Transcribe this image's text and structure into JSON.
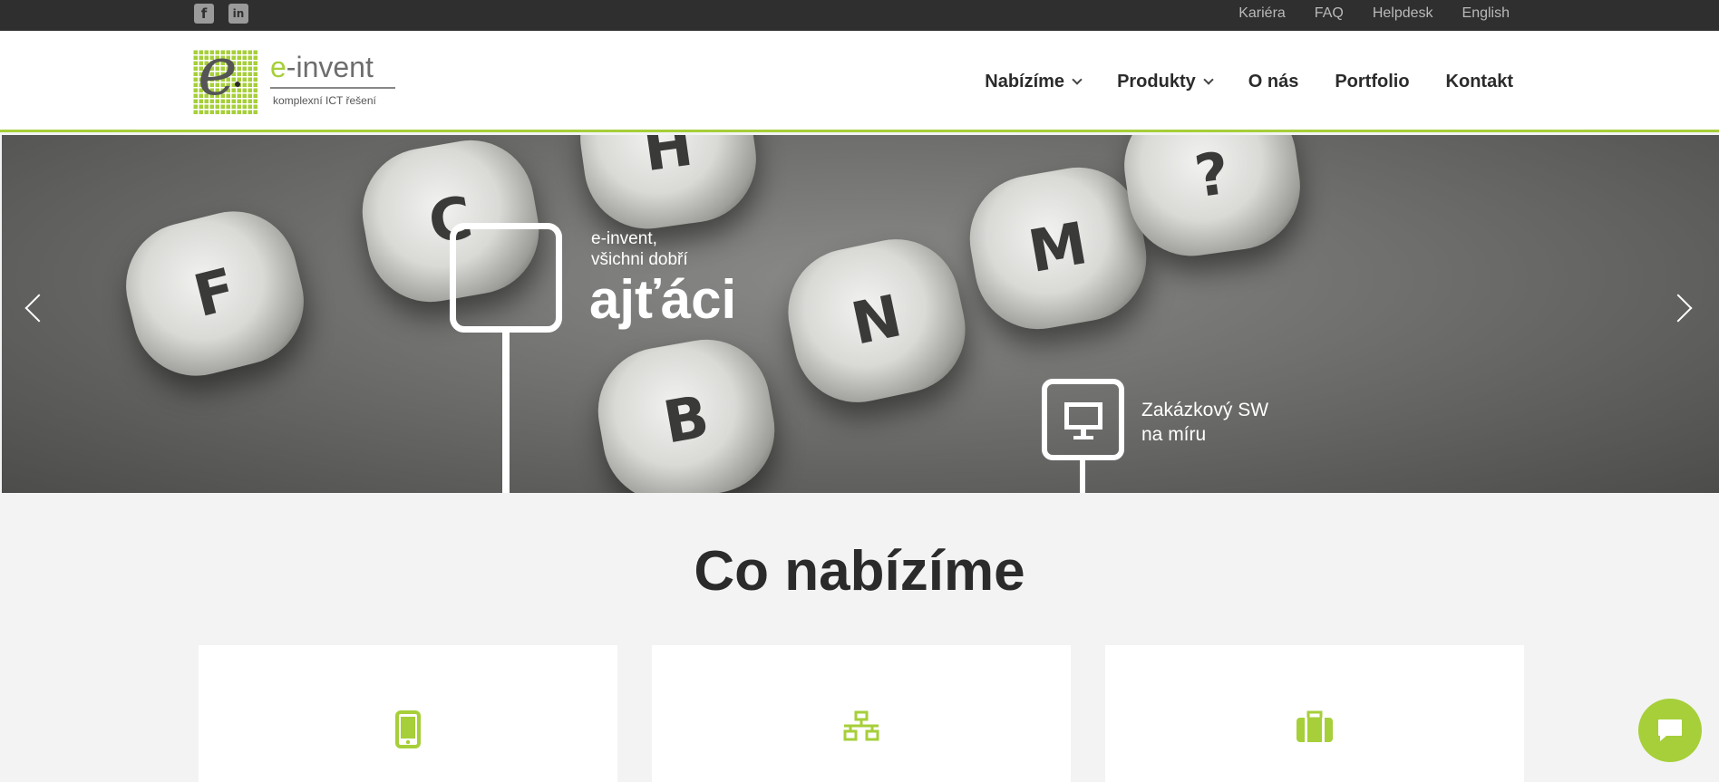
{
  "topbar": {
    "social": [
      {
        "icon": "facebook-icon",
        "glyph": "f"
      },
      {
        "icon": "linkedin-icon",
        "glyph": "in"
      }
    ],
    "links": [
      "Kariéra",
      "FAQ",
      "Helpdesk",
      "English"
    ]
  },
  "logo": {
    "prefix": "e",
    "name": "-invent",
    "tagline": "komplexní ICT řešení"
  },
  "nav": {
    "items": [
      {
        "label": "Nabízíme",
        "dropdown": true
      },
      {
        "label": "Produkty",
        "dropdown": true
      },
      {
        "label": "O nás",
        "dropdown": false
      },
      {
        "label": "Portfolio",
        "dropdown": false
      },
      {
        "label": "Kontakt",
        "dropdown": false
      }
    ]
  },
  "hero": {
    "line1": "e-invent,",
    "line2": "všichni dobří",
    "big": "ajťáci",
    "sw_line1": "Zakázkový SW",
    "sw_line2": "na míru",
    "keys": [
      "F",
      "C",
      "H",
      "N",
      "M",
      "B",
      "?"
    ]
  },
  "offer": {
    "title": "Co nabízíme",
    "cards": [
      {
        "icon": "mobile-icon"
      },
      {
        "icon": "network-icon"
      },
      {
        "icon": "briefcase-icon"
      }
    ]
  },
  "colors": {
    "accent": "#a6cf39",
    "topbar": "#2f2f2f",
    "background": "#f3f3f3"
  }
}
